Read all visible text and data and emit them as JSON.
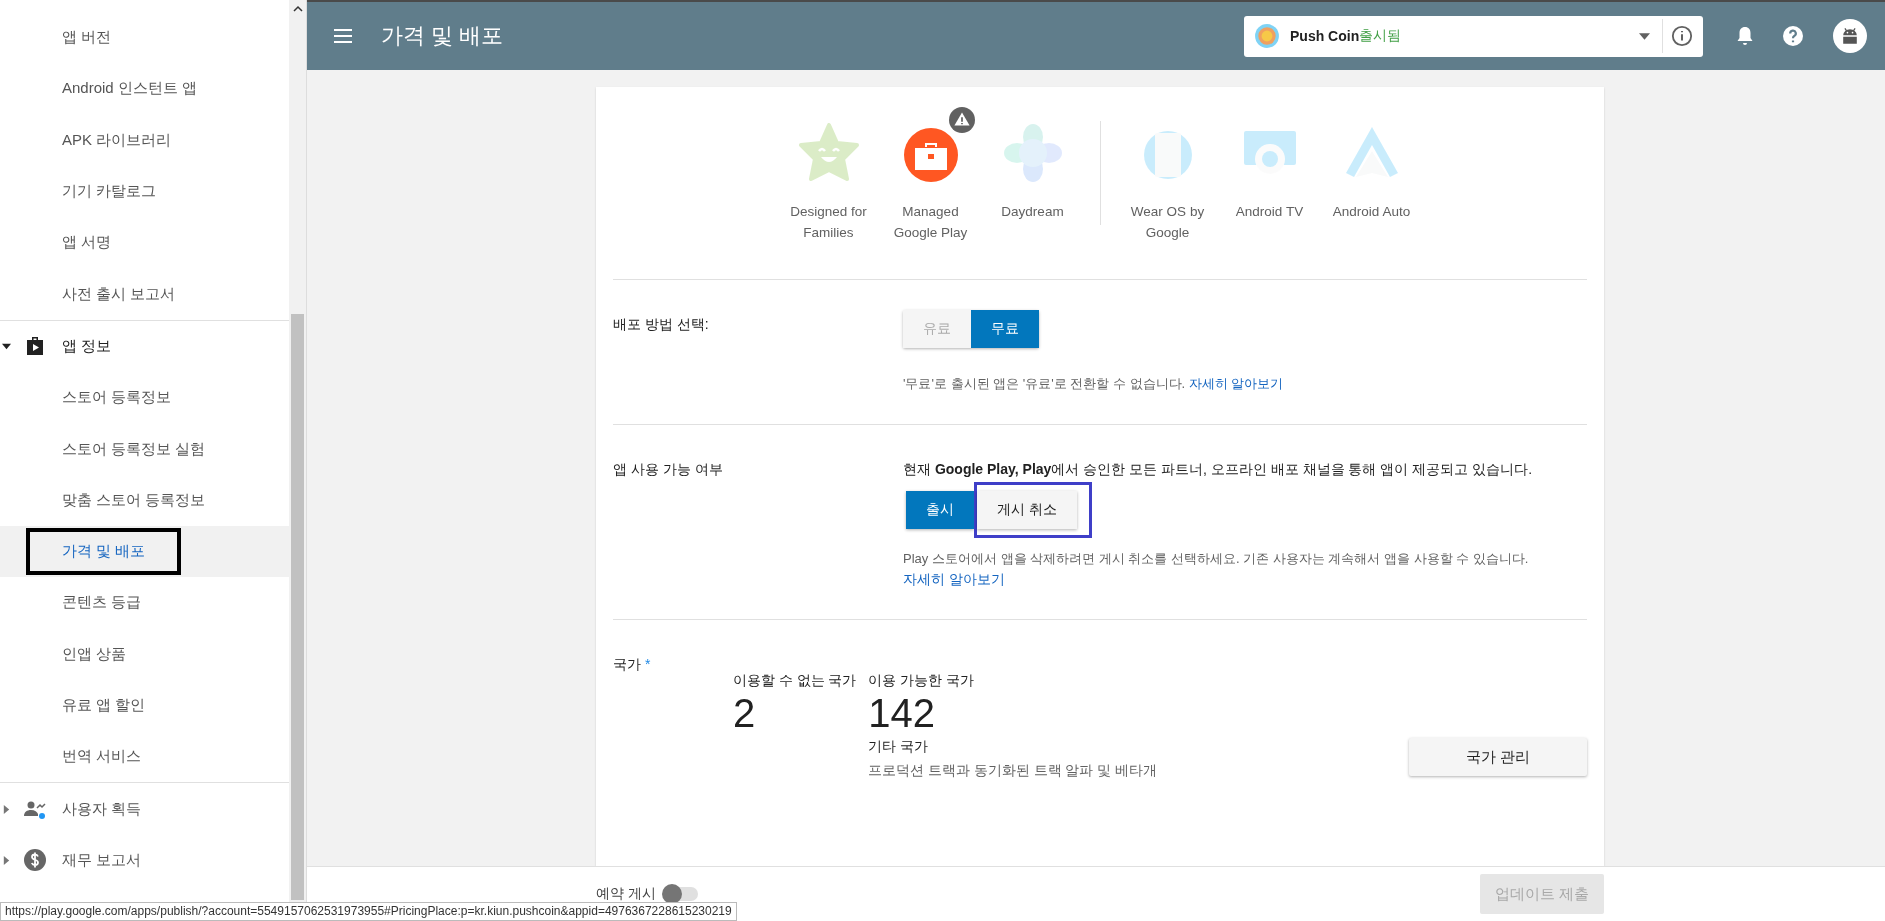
{
  "header": {
    "title": "가격 및 배포",
    "app_selector": {
      "name": "Push Coin",
      "status": "출시됨"
    }
  },
  "sidebar": {
    "items": [
      {
        "label": "앱 버전",
        "selected": false,
        "highlighted": false
      },
      {
        "label": "Android 인스턴트 앱",
        "selected": false,
        "highlighted": false
      },
      {
        "label": "APK 라이브러리",
        "selected": false,
        "highlighted": false
      },
      {
        "label": "기기 카탈로그",
        "selected": false,
        "highlighted": false
      },
      {
        "label": "앱 서명",
        "selected": false,
        "highlighted": false
      },
      {
        "label": "사전 출시 보고서",
        "selected": false,
        "highlighted": false
      }
    ],
    "groups": [
      {
        "label": "앱 정보",
        "expanded": true,
        "children": [
          {
            "label": "스토어 등록정보",
            "selected": false,
            "highlighted": false
          },
          {
            "label": "스토어 등록정보 실험",
            "selected": false,
            "highlighted": false
          },
          {
            "label": "맞춤 스토어 등록정보",
            "selected": false,
            "highlighted": false
          },
          {
            "label": "가격 및 배포",
            "selected": true,
            "highlighted": true
          },
          {
            "label": "콘텐츠 등급",
            "selected": false,
            "highlighted": false
          },
          {
            "label": "인앱 상품",
            "selected": false,
            "highlighted": false
          },
          {
            "label": "유료 앱 할인",
            "selected": false,
            "highlighted": false
          },
          {
            "label": "번역 서비스",
            "selected": false,
            "highlighted": false
          }
        ]
      },
      {
        "label": "사용자 획득",
        "expanded": false
      },
      {
        "label": "재무 보고서",
        "expanded": false
      }
    ]
  },
  "devices": [
    {
      "kind": "families",
      "label": "Designed for Families",
      "active": false,
      "warning": false
    },
    {
      "kind": "managed",
      "label": "Managed Google Play",
      "active": true,
      "warning": true
    },
    {
      "kind": "daydream",
      "label": "Daydream",
      "active": false,
      "warning": false
    },
    {
      "kind": "wear",
      "label": "Wear OS by Google",
      "active": false,
      "warning": false
    },
    {
      "kind": "tv",
      "label": "Android TV",
      "active": false,
      "warning": false
    },
    {
      "kind": "auto",
      "label": "Android Auto",
      "active": false,
      "warning": false
    }
  ],
  "pricing": {
    "label": "배포 방법 선택:",
    "options": [
      {
        "label": "유료",
        "selected": false
      },
      {
        "label": "무료",
        "selected": true
      }
    ],
    "note": "'무료'로 출시된 앱은 '유료'로 전환할 수 없습니다.",
    "link": "자세히 알아보기"
  },
  "availability": {
    "label": "앱 사용 가능 여부",
    "text": "현재 **Google Play, Play**에서 승인한 모든 파트너, 오프라인 배포 채널을 통해 앱이 제공되고 있습니다.",
    "buttons": [
      {
        "label": "출시",
        "selected": true,
        "highlighted": false
      },
      {
        "label": "게시 취소",
        "selected": false,
        "highlighted": true
      }
    ],
    "note": "Play 스토어에서 앱을 삭제하려면 게시 취소를 선택하세요. 기존 사용자는 계속해서 앱을 사용할 수 있습니다.",
    "link": "자세히 알아보기"
  },
  "countries": {
    "label": "국가",
    "required_mark": "*",
    "stats": [
      {
        "label": "이용할 수 없는 국가",
        "value": "2"
      },
      {
        "label": "이용 가능한 국가",
        "value": "142"
      }
    ],
    "other_label": "기타 국가",
    "other_description": "프로덕션 트랙과 동기화된 트랙 알파 및 베타개",
    "button": "국가 관리"
  },
  "footer": {
    "schedule": {
      "label": "예약 게시",
      "on": false
    },
    "submit": {
      "label": "업데이트 제출",
      "disabled": true
    }
  },
  "status_url": "https://play.google.com/apps/publish/?account=5549157062531973955#PricingPlace:p=kr.kiun.pushcoin&appid=4976367228615230219"
}
